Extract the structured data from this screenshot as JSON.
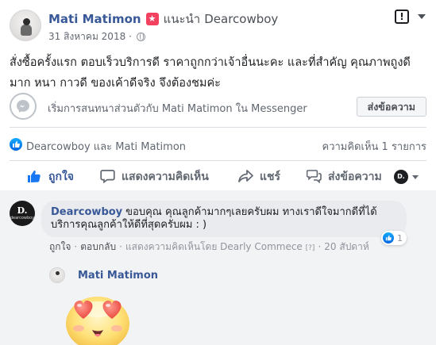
{
  "post": {
    "author": "Mati Matimon",
    "recommends_text": "แนะนำ",
    "recommended_page": "Dearcowboy",
    "date": "31 สิงหาคม 2018 ·",
    "text": "สั่งซื้อครั้งแรก ตอบเร็วบริการดี ราคาถูกกว่าเจ้าอื่นนะคะ และที่สำคัญ คุณภาพถูงดี มาก หนา กาวดี ของเค้าดีจริง จึงต้องชมค่ะ",
    "report_icon": "!"
  },
  "messenger": {
    "prompt": "เริ่มการสนทนาส่วนตัวกับ Mati Matimon ใน Messenger",
    "send_button": "ส่งข้อความ"
  },
  "reactions": {
    "names": "Dearcowboy และ Mati Matimon",
    "comment_count": "ความคิดเห็น 1 รายการ"
  },
  "actions": {
    "like": "ถูกใจ",
    "comment": "แสดงความคิดเห็น",
    "share": "แชร์",
    "send": "ส่งข้อความ",
    "page_avatar_text": "D."
  },
  "comment": {
    "author": "Dearcowboy",
    "text": "ขอบคุณ คุณลูกค้ามากๆเลยครับผม ทางเราดีใจมากดีที่ได้บริการคุณลูกค้าให้ดีที่สุดครับผม : )",
    "like_count": "1",
    "avatar_line1": "D.",
    "avatar_line2": "dearcowboy",
    "action_like": "ถูกใจ",
    "action_reply": "ตอบกลับ",
    "by_text": "แสดงความคิดเห็นโดย Dearly Commece",
    "info_mark": "[?]",
    "time": "20 สัปดาห์"
  },
  "reply": {
    "author": "Mati Matimon",
    "sticker": "heart-eyes-sticker"
  },
  "colors": {
    "link_blue": "#385898",
    "like_blue": "#1877f2",
    "badge_red": "#f3425f",
    "gray_text": "#616770"
  }
}
